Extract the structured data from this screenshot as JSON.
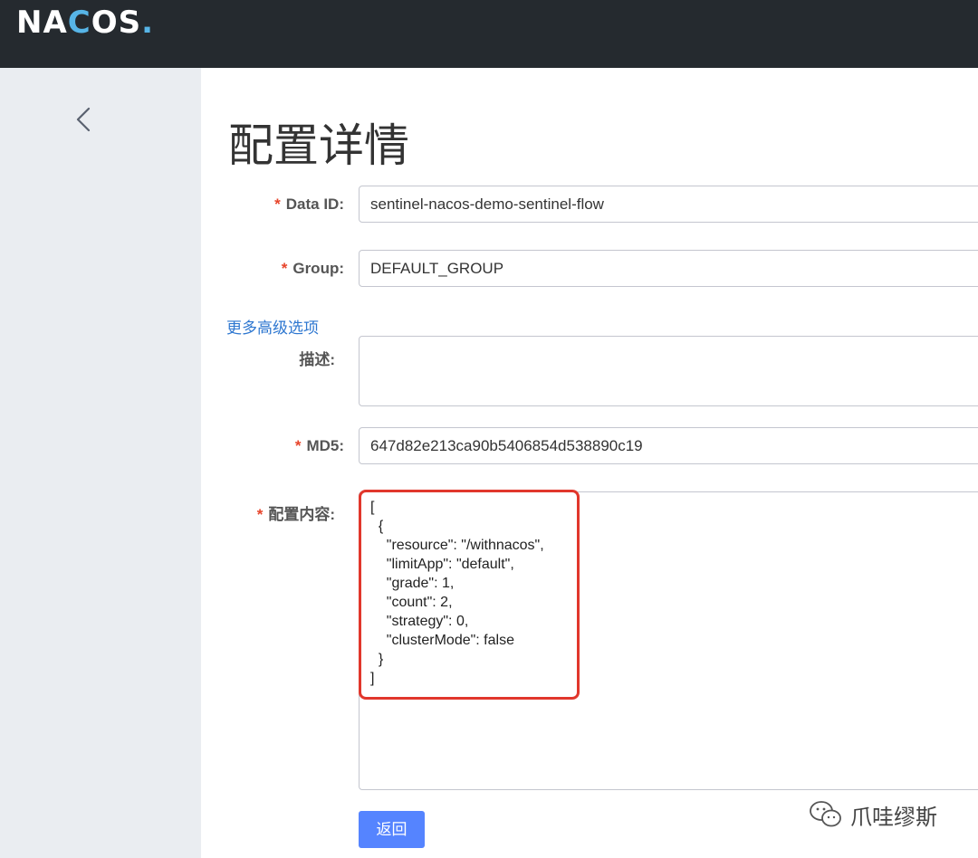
{
  "header": {
    "logo_text_a": "NA",
    "logo_text_c": "C",
    "logo_text_b": "OS",
    "logo_dot": ".",
    "accent_color": "#57b5e7"
  },
  "page": {
    "title": "配置详情"
  },
  "form": {
    "data_id": {
      "label": "Data ID:",
      "required": "*",
      "value": "sentinel-nacos-demo-sentinel-flow"
    },
    "group": {
      "label": "Group:",
      "required": "*",
      "value": "DEFAULT_GROUP"
    },
    "advanced_link": "更多高级选项",
    "description": {
      "label": "描述:",
      "value": ""
    },
    "md5": {
      "label": "MD5:",
      "required": "*",
      "value": "647d82e213ca90b5406854d538890c19"
    },
    "content": {
      "label": "配置内容:",
      "required": "*",
      "value": "[\n  {\n    \"resource\": \"/withnacos\",\n    \"limitApp\": \"default\",\n    \"grade\": 1,\n    \"count\": 2,\n    \"strategy\": 0,\n    \"clusterMode\": false\n  }\n]"
    },
    "back_button": "返回"
  },
  "watermark": {
    "text": "爪哇缪斯",
    "icon": "wechat-icon"
  },
  "colors": {
    "required": "#e7442a",
    "link": "#2e77d0",
    "primary_button": "#5584ff",
    "highlight_box": "#e1372c"
  }
}
